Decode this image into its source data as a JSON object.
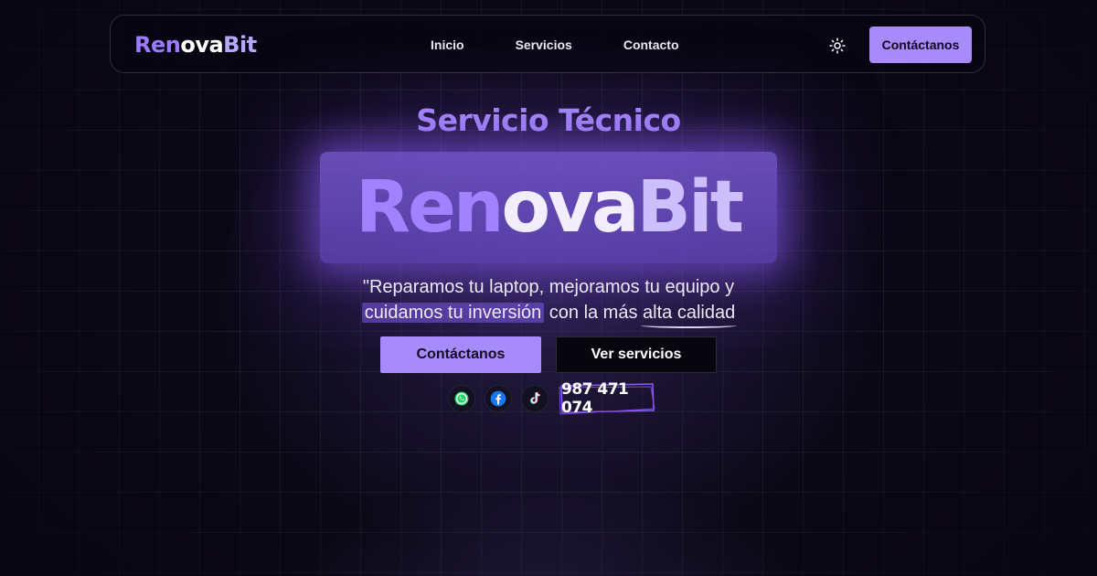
{
  "brand": {
    "logo_part1": "Ren",
    "logo_part2": "ova",
    "logo_part3": "Bit",
    "accent_color": "#a78bfa"
  },
  "nav": {
    "links": [
      {
        "label": "Inicio"
      },
      {
        "label": "Servicios"
      },
      {
        "label": "Contacto"
      }
    ],
    "theme_toggle_icon": "sun-icon",
    "cta_label": "Contáctanos"
  },
  "hero": {
    "subtitle": "Servicio Técnico",
    "logo_part1": "Ren",
    "logo_part2": "ova",
    "logo_part3": "Bit",
    "quote_line1": "\"Reparamos tu laptop, mejoramos tu equipo y",
    "quote_highlight": "cuidamos tu inversión",
    "quote_mid": " con la más ",
    "quote_underlined": "alta calidad",
    "primary_button": "Contáctanos",
    "secondary_button": "Ver servicios"
  },
  "social": {
    "icons": [
      "whatsapp-icon",
      "facebook-icon",
      "tiktok-icon"
    ],
    "phone": "987 471 074"
  }
}
